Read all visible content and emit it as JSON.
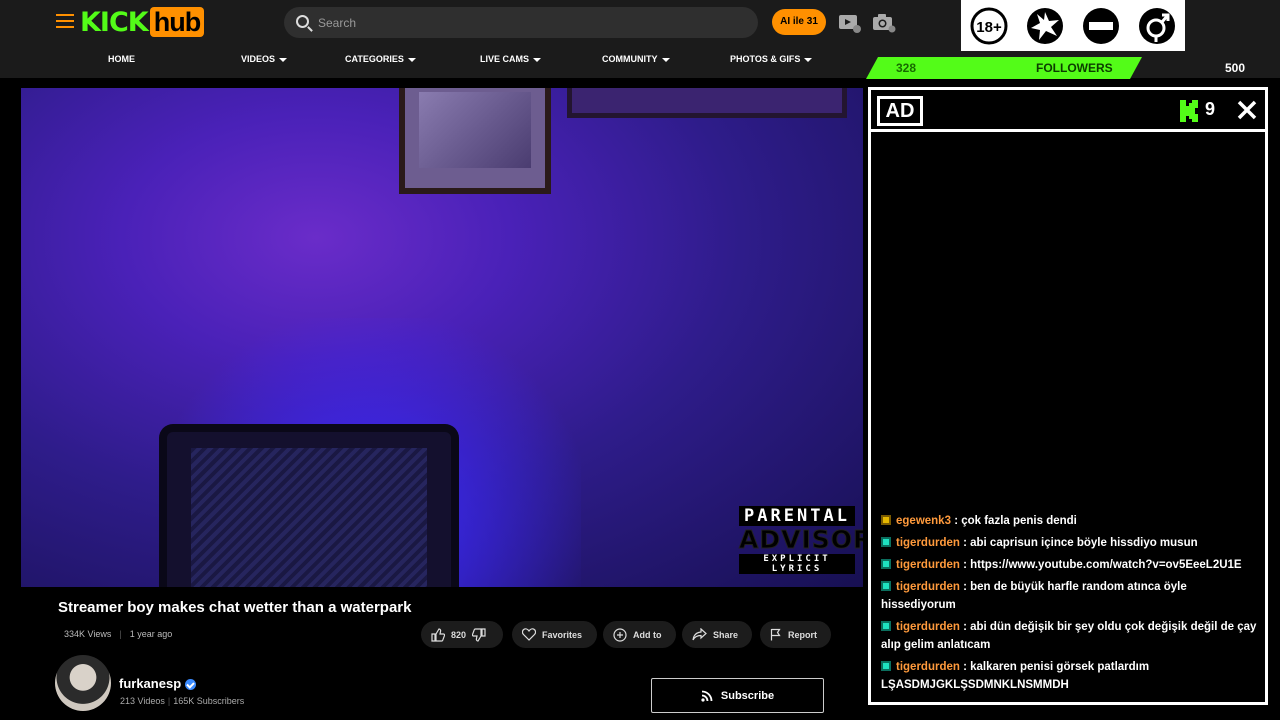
{
  "header": {
    "logo_kick": "KICK",
    "logo_hub": "hub",
    "search_placeholder": "Search",
    "ai_pill": "AI ile 31",
    "nav": [
      {
        "label": "HOME"
      },
      {
        "label": "VIDEOS"
      },
      {
        "label": "CATEGORIES"
      },
      {
        "label": "LIVE CAMS"
      },
      {
        "label": "COMMUNITY"
      },
      {
        "label": "PHOTOS & GIFS"
      }
    ]
  },
  "ratings": {
    "age_label": "18+"
  },
  "followers": {
    "current": "328",
    "label": "FOLLOWERS",
    "goal": "500",
    "progress": 0.656
  },
  "player": {
    "advisory_top": "PARENTAL",
    "advisory_mid": "ADVISORY",
    "advisory_bottom": "EXPLICIT LYRICS"
  },
  "video": {
    "title": "Streamer boy makes chat wetter than a waterpark",
    "views": "334K Views",
    "age": "1 year ago",
    "likes": "820",
    "favorites_label": "Favorites",
    "add_to_label": "Add to",
    "share_label": "Share",
    "report_label": "Report"
  },
  "channel": {
    "name": "furkanesp",
    "videos": "213 Videos",
    "subscribers": "165K Subscribers",
    "subscribe_label": "Subscribe"
  },
  "chat": {
    "ad_label": "AD",
    "count": "9",
    "messages": [
      {
        "user": "egewenk3",
        "text": ": çok fazla penis dendi",
        "badge": "gold"
      },
      {
        "user": "tigerdurden",
        "text": ": abi caprisun içince böyle hissdiyo musun",
        "badge": "green"
      },
      {
        "user": "tigerdurden",
        "text": ": https://www.youtube.com/watch?v=ov5EeeL2U1E",
        "badge": "green"
      },
      {
        "user": "tigerdurden",
        "text": ": ben de büyük harfle random atınca öyle hissediyorum",
        "badge": "green"
      },
      {
        "user": "tigerdurden",
        "text": ": abi dün değişik bir şey oldu çok değişik değil de çay alıp gelim anlatıcam",
        "badge": "green"
      },
      {
        "user": "tigerdurden",
        "text": ": kalkaren penisi görsek patlardım LŞASDMJGKLŞSDMNKLNSMMDH",
        "badge": "green"
      }
    ]
  },
  "colors": {
    "accent_orange": "#ff9000",
    "kick_green": "#53fc18",
    "username_orange": "#ff9a3c"
  }
}
